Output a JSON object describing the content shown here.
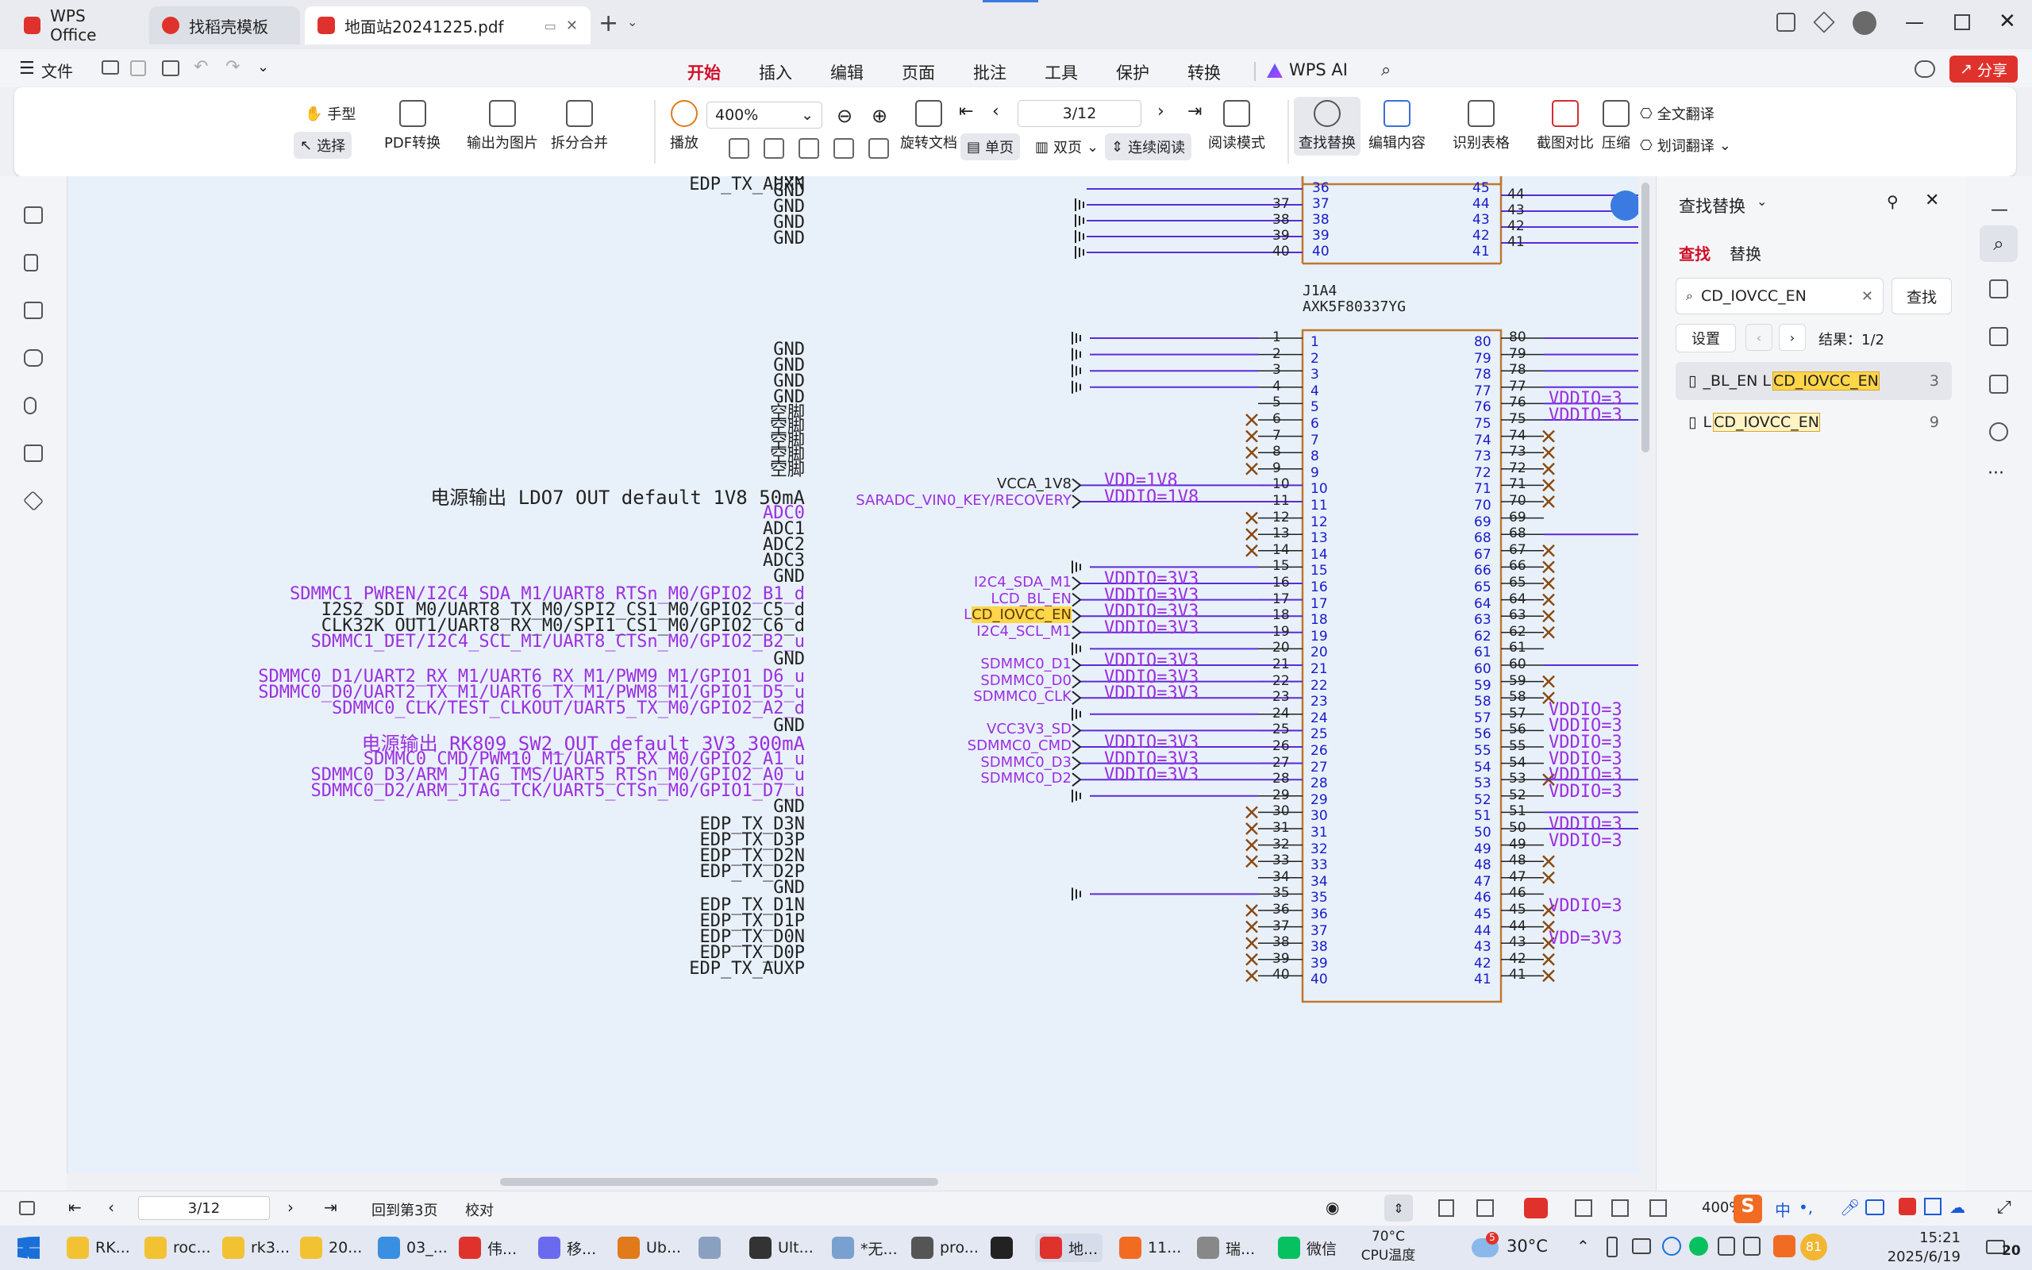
{
  "title_tabs": [
    {
      "label": "WPS Office",
      "color": "#e0322c"
    },
    {
      "label": "找稻壳模板",
      "color": "#e0322c"
    },
    {
      "label": "地面站20241225.pdf",
      "color": "#e0322c"
    }
  ],
  "menu": {
    "file_label": "文件",
    "items": [
      "开始",
      "插入",
      "编辑",
      "页面",
      "批注",
      "工具",
      "保护",
      "转换",
      "WPS AI"
    ],
    "active": "开始",
    "share_label": "分享"
  },
  "toolbar": {
    "hand": "手型",
    "select": "选择",
    "pdf_convert": "PDF转换",
    "export_image": "输出为图片",
    "split_merge": "拆分合并",
    "play": "播放",
    "zoom": "400%",
    "page": "3/12",
    "rotate": "旋转文档",
    "single": "单页",
    "double": "双页",
    "continuous": "连续阅读",
    "read_mode": "阅读模式",
    "find_replace": "查找替换",
    "edit_content": "编辑内容",
    "recognize_table": "识别表格",
    "screenshot_compare": "截图对比",
    "compress": "压缩",
    "full_translate": "全文翻译",
    "word_translate": "划词翻译"
  },
  "document": {
    "left_labels": [
      {
        "text": "GND",
        "cls": "bk"
      },
      {
        "text": "GND",
        "cls": "bk"
      },
      {
        "text": "GND",
        "cls": "bk"
      },
      {
        "text": "GND",
        "cls": "bk"
      },
      {
        "text": "GND",
        "cls": "bk"
      },
      {
        "text": "GND",
        "cls": "bk"
      },
      {
        "text": "GND",
        "cls": "bk"
      },
      {
        "text": "GND",
        "cls": "bk"
      },
      {
        "text": "GND",
        "cls": "bk"
      },
      {
        "text": "空脚",
        "cls": "bk"
      },
      {
        "text": "空脚",
        "cls": "bk"
      },
      {
        "text": "空脚",
        "cls": "bk"
      },
      {
        "text": "空脚",
        "cls": "bk"
      },
      {
        "text": "空脚",
        "cls": "bk"
      },
      {
        "text": "电源输出  LDO7 OUT default 1V8 50mA",
        "cls": "bk"
      },
      {
        "text": "ADC0",
        "cls": "pu"
      },
      {
        "text": "ADC1",
        "cls": "bk"
      },
      {
        "text": "ADC2",
        "cls": "bk"
      },
      {
        "text": "ADC3",
        "cls": "bk"
      },
      {
        "text": "GND",
        "cls": "bk"
      },
      {
        "text": "SDMMC1_PWREN/I2C4_SDA_M1/UART8_RTSn_M0/GPIO2_B1_d",
        "cls": "pu"
      },
      {
        "text": "I2S2_SDI_M0/UART8_TX_M0/SPI2_CS1_M0/GPIO2_C5_d",
        "cls": "bk"
      },
      {
        "text": "CLK32K_OUT1/UART8_RX_M0/SPI1_CS1_M0/GPIO2_C6_d",
        "cls": "bk"
      },
      {
        "text": "SDMMC1_DET/I2C4_SCL_M1/UART8_CTSn_M0/GPIO2_B2_u",
        "cls": "pu"
      },
      {
        "text": "GND",
        "cls": "bk"
      },
      {
        "text": "SDMMC0_D1/UART2_RX_M1/UART6_RX_M1/PWM9_M1/GPIO1_D6_u",
        "cls": "pu"
      },
      {
        "text": "SDMMC0_D0/UART2_TX_M1/UART6_TX_M1/PWM8_M1/GPIO1_D5_u",
        "cls": "pu"
      },
      {
        "text": "SDMMC0_CLK/TEST_CLKOUT/UART5_TX_M0/GPIO2_A2_d",
        "cls": "pu"
      },
      {
        "text": "GND",
        "cls": "bk"
      },
      {
        "text": "电源输出  RK809_SW2_OUT default 3V3 300mA",
        "cls": "pu"
      },
      {
        "text": "SDMMC0_CMD/PWM10_M1/UART5_RX_M0/GPIO2_A1_u",
        "cls": "pu"
      },
      {
        "text": "SDMMC0_D3/ARM_JTAG_TMS/UART5_RTSn_M0/GPIO2_A0_u",
        "cls": "pu"
      },
      {
        "text": "SDMMC0_D2/ARM_JTAG_TCK/UART5_CTSn_M0/GPIO1_D7_u",
        "cls": "pu"
      },
      {
        "text": "GND",
        "cls": "bk"
      },
      {
        "text": "EDP_TX_D3N",
        "cls": "bk"
      },
      {
        "text": "EDP_TX_D3P",
        "cls": "bk"
      },
      {
        "text": "EDP_TX_D2N",
        "cls": "bk"
      },
      {
        "text": "EDP_TX_D2P",
        "cls": "bk"
      },
      {
        "text": "GND",
        "cls": "bk"
      },
      {
        "text": "EDP_TX_D1N",
        "cls": "bk"
      },
      {
        "text": "EDP_TX_D1P",
        "cls": "bk"
      },
      {
        "text": "EDP_TX_D0N",
        "cls": "bk"
      },
      {
        "text": "EDP_TX_D0P",
        "cls": "bk"
      },
      {
        "text": "EDP_TX_AUXP",
        "cls": "bk"
      },
      {
        "text": "EDP_TX_AUXN",
        "cls": "bk"
      }
    ],
    "connector_ref": "J1A4",
    "connector_part": "AXK5F80337YG",
    "top_pins_left": [
      "37",
      "38",
      "39",
      "40"
    ],
    "top_pins_inner_left": [
      "36",
      "37",
      "38",
      "39",
      "40"
    ],
    "top_pins_inner_right": [
      "45",
      "44",
      "43",
      "42",
      "41"
    ],
    "top_pins_right": [
      "44",
      "43",
      "42",
      "41"
    ],
    "left_pins": [
      "1",
      "2",
      "3",
      "4",
      "5",
      "6",
      "7",
      "8",
      "9",
      "10",
      "11",
      "12",
      "13",
      "14",
      "15",
      "16",
      "17",
      "18",
      "19",
      "20",
      "21",
      "22",
      "23",
      "24",
      "25",
      "26",
      "27",
      "28",
      "29",
      "30",
      "31",
      "32",
      "33",
      "34",
      "35",
      "36",
      "37",
      "38",
      "39",
      "40"
    ],
    "inner_left_pins": [
      "1",
      "2",
      "3",
      "4",
      "5",
      "6",
      "7",
      "8",
      "9",
      "10",
      "11",
      "12",
      "13",
      "14",
      "15",
      "16",
      "17",
      "18",
      "19",
      "20",
      "21",
      "22",
      "23",
      "24",
      "25",
      "26",
      "27",
      "28",
      "29",
      "30",
      "31",
      "32",
      "33",
      "34",
      "35",
      "36",
      "37",
      "38",
      "39",
      "40"
    ],
    "inner_right_pins": [
      "80",
      "79",
      "78",
      "77",
      "76",
      "75",
      "74",
      "73",
      "72",
      "71",
      "70",
      "69",
      "68",
      "67",
      "66",
      "65",
      "64",
      "63",
      "62",
      "61",
      "60",
      "59",
      "58",
      "57",
      "56",
      "55",
      "54",
      "53",
      "52",
      "51",
      "50",
      "49",
      "48",
      "47",
      "46",
      "45",
      "44",
      "43",
      "42",
      "41"
    ],
    "right_pins": [
      "80",
      "79",
      "78",
      "77",
      "76",
      "75",
      "74",
      "73",
      "72",
      "71",
      "70",
      "69",
      "68",
      "67",
      "66",
      "65",
      "64",
      "63",
      "62",
      "61",
      "60",
      "59",
      "58",
      "57",
      "56",
      "55",
      "54",
      "53",
      "52",
      "51",
      "50",
      "49",
      "48",
      "47",
      "46",
      "45",
      "44",
      "43",
      "42",
      "41"
    ],
    "nets": [
      {
        "label": "VCCA_1V8",
        "volt": "VDD=1V8",
        "pin": 10,
        "cls": "bk"
      },
      {
        "label": "SARADC_VIN0_KEY/RECOVERY",
        "volt": "VDDIO=1V8",
        "pin": 11,
        "cls": "pu"
      },
      {
        "label": "I2C4_SDA_M1",
        "volt": "VDDIO=3V3",
        "pin": 16,
        "cls": "pu"
      },
      {
        "label": "LCD_BL_EN",
        "volt": "VDDIO=3V3",
        "pin": 17,
        "cls": "pu"
      },
      {
        "label": "LCD_IOVCC_EN",
        "volt": "VDDIO=3V3",
        "pin": 18,
        "cls": "pu"
      },
      {
        "label": "I2C4_SCL_M1",
        "volt": "VDDIO=3V3",
        "pin": 19,
        "cls": "pu"
      },
      {
        "label": "SDMMC0_D1",
        "volt": "VDDIO=3V3",
        "pin": 21,
        "cls": "pu"
      },
      {
        "label": "SDMMC0_D0",
        "volt": "VDDIO=3V3",
        "pin": 22,
        "cls": "pu"
      },
      {
        "label": "SDMMC0_CLK",
        "volt": "VDDIO=3V3",
        "pin": 23,
        "cls": "pu"
      },
      {
        "label": "VCC3V3_SD",
        "volt": "",
        "pin": 25,
        "cls": "pu"
      },
      {
        "label": "SDMMC0_CMD",
        "volt": "VDDIO=3V3",
        "pin": 26,
        "cls": "pu"
      },
      {
        "label": "SDMMC0_D3",
        "volt": "VDDIO=3V3",
        "pin": 27,
        "cls": "pu"
      },
      {
        "label": "SDMMC0_D2",
        "volt": "VDDIO=3V3",
        "pin": 28,
        "cls": "pu"
      }
    ],
    "right_volts": [
      {
        "text": "VDDIO=3",
        "pin": 76
      },
      {
        "text": "VDDIO=3",
        "pin": 75
      },
      {
        "text": "VDDIO=3",
        "pin": 57
      },
      {
        "text": "VDDIO=3",
        "pin": 56
      },
      {
        "text": "VDDIO=3",
        "pin": 55
      },
      {
        "text": "VDDIO=3",
        "pin": 54
      },
      {
        "text": "VDDIO=3",
        "pin": 53
      },
      {
        "text": "VDDIO=3",
        "pin": 52
      },
      {
        "text": "VDDIO=3",
        "pin": 50
      },
      {
        "text": "VDDIO=3",
        "pin": 49
      },
      {
        "text": "VDDIO=3",
        "pin": 45
      },
      {
        "text": "VDD=3V3",
        "pin": 43
      }
    ]
  },
  "find_panel": {
    "title": "查找替换",
    "tab_find": "查找",
    "tab_replace": "替换",
    "query": "CD_IOVCC_EN",
    "search_button": "查找",
    "settings_button": "设置",
    "result_count": "结果：1/2",
    "results": [
      {
        "prefix": "_BL_EN L",
        "match": "CD_IOVCC_EN",
        "page": "3"
      },
      {
        "prefix": "L",
        "match": "CD_IOVCC_EN",
        "page": "9"
      }
    ]
  },
  "status": {
    "page": "3/12",
    "back_to_page": "回到第3页",
    "proofread": "校对",
    "zoom": "400%"
  },
  "taskbar": {
    "items": [
      "RK...",
      "roc...",
      "rk3...",
      "20...",
      "03_...",
      "伟...",
      "移...",
      "Ub...",
      "",
      "Ult...",
      "*无...",
      "pro...",
      "",
      "地...",
      "11...",
      "瑞...",
      "微信"
    ],
    "cpu_temp": "70°C",
    "cpu_label": "CPU温度",
    "weather": "30°C",
    "weather_badge": "5",
    "ime": "中",
    "time": "15:21",
    "date": "2025/6/19",
    "notify": "20",
    "battery_badge": "81"
  }
}
